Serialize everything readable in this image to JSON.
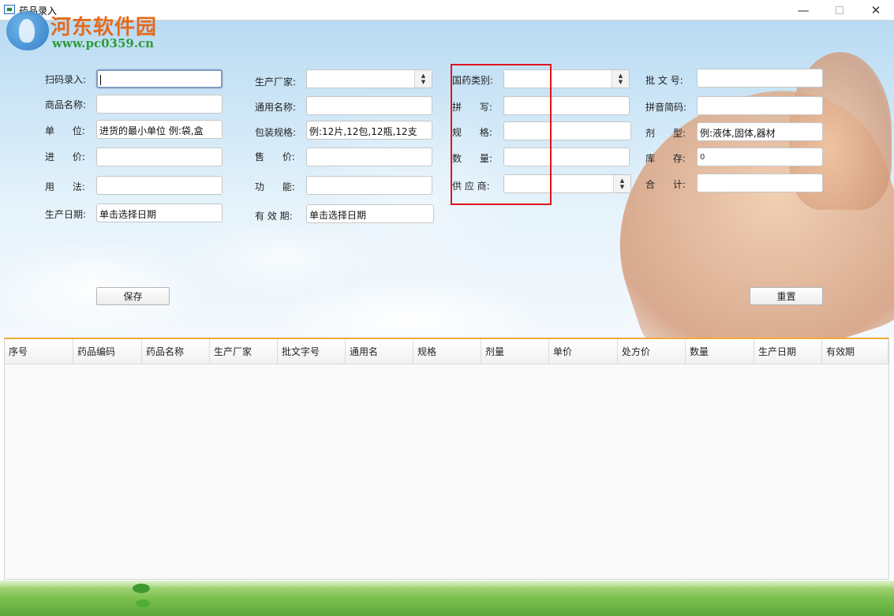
{
  "window": {
    "title": "药品录入",
    "minimize": "—",
    "close": "✕"
  },
  "watermark": {
    "title": "河东软件园",
    "url": "www.pc0359.cn"
  },
  "form": {
    "col1": [
      {
        "label": "扫码录入:",
        "value": ""
      },
      {
        "label": "商品名称:",
        "value": ""
      },
      {
        "label": "单      位:",
        "value": "进货的最小单位 例:袋,盒"
      },
      {
        "label": "进      价:",
        "value": ""
      },
      {
        "label": "用      法:",
        "value": ""
      },
      {
        "label": "生产日期:",
        "value": "单击选择日期"
      }
    ],
    "col2": [
      {
        "label": "生产厂家:",
        "value": ""
      },
      {
        "label": "通用名称:",
        "value": ""
      },
      {
        "label": "包装规格:",
        "value": "例:12片,12包,12瓶,12支"
      },
      {
        "label": "售      价:",
        "value": ""
      },
      {
        "label": "功      能:",
        "value": ""
      },
      {
        "label": "有 效 期:",
        "value": "单击选择日期"
      }
    ],
    "col3": [
      {
        "label": "国药类别:",
        "value": ""
      },
      {
        "label": "拼      写:",
        "value": ""
      },
      {
        "label": "规      格:",
        "value": ""
      },
      {
        "label": "数      量:",
        "value": ""
      },
      {
        "label": "供 应 商:",
        "value": ""
      }
    ],
    "col4": [
      {
        "label": "批 文 号:",
        "value": ""
      },
      {
        "label": "拼音简码:",
        "value": ""
      },
      {
        "label": "剂      型:",
        "value": "例:液体,固体,器材"
      },
      {
        "label": "库      存:",
        "value": "0"
      },
      {
        "label": "合      计:",
        "value": ""
      }
    ],
    "save_label": "保存",
    "reset_label": "重置"
  },
  "table": {
    "columns": [
      "序号",
      "药品编码",
      "药品名称",
      "生产厂家",
      "批文字号",
      "通用名",
      "规格",
      "剂量",
      "单价",
      "处方价",
      "数量",
      "生产日期",
      "有效期"
    ],
    "rows": []
  },
  "colors": {
    "highlight_box": "#e0141c",
    "table_top_border": "#f0a93c",
    "watermark_title": "#e46a1c",
    "watermark_url": "#2f9a3a"
  }
}
